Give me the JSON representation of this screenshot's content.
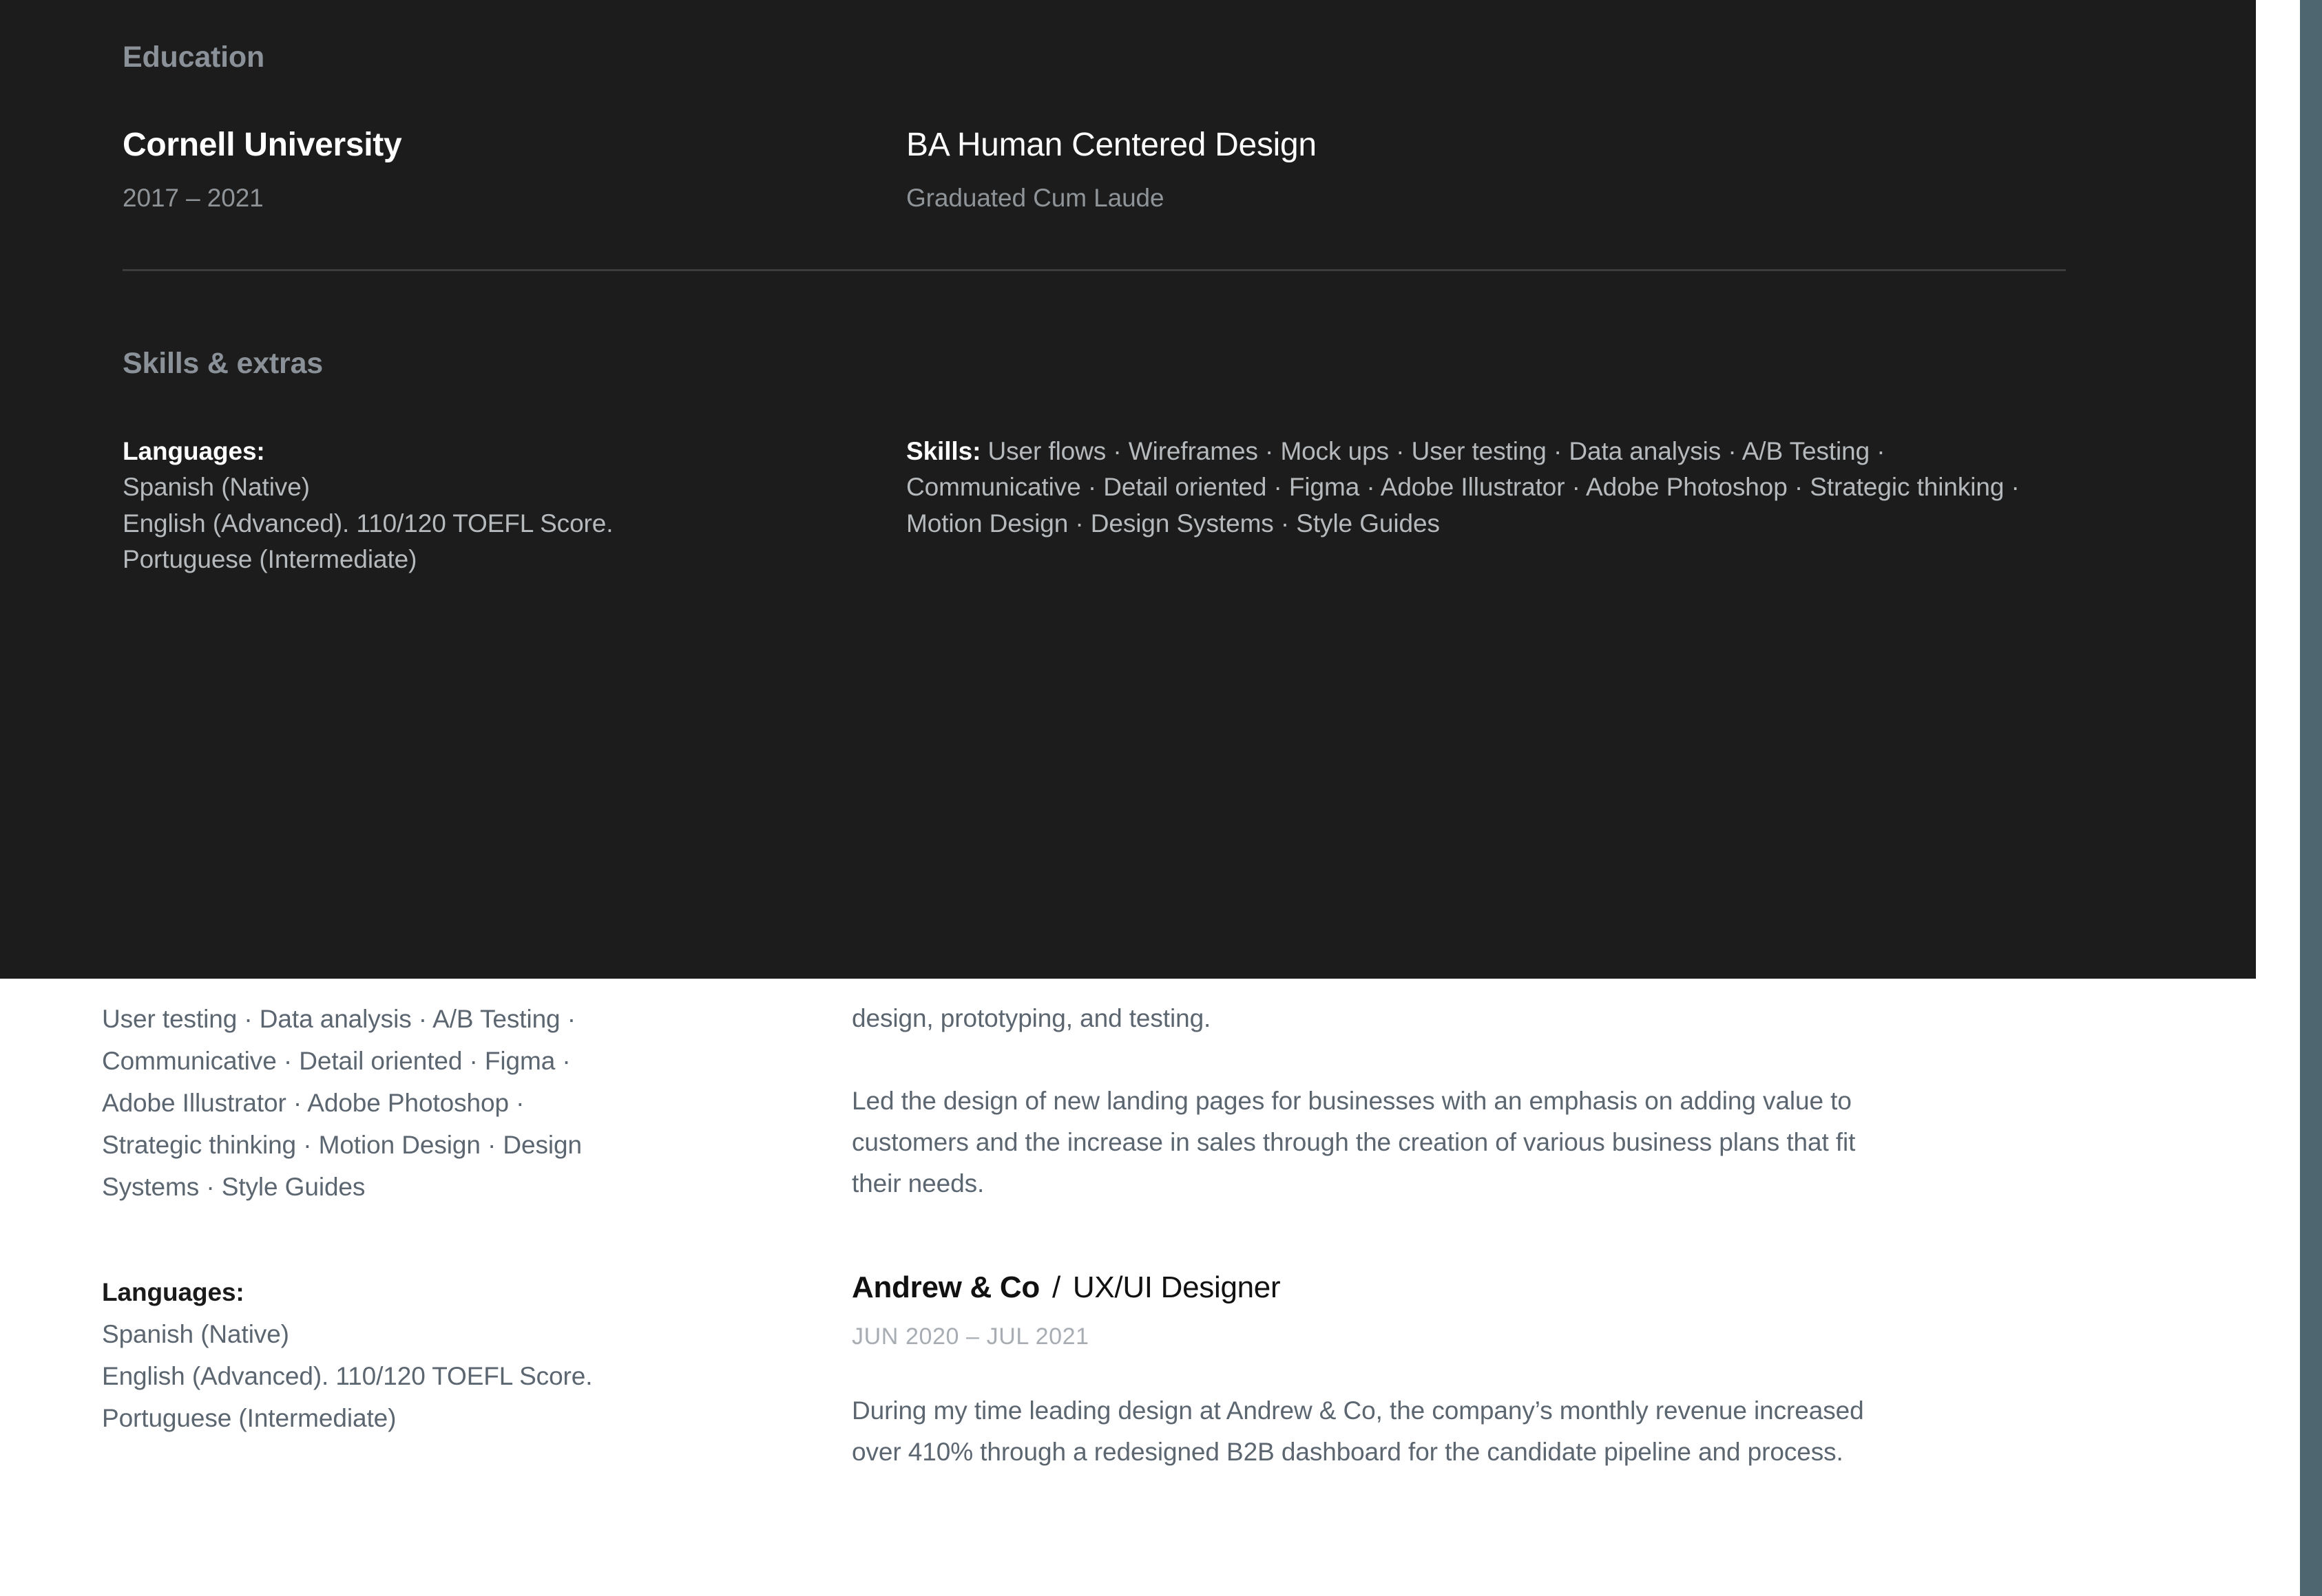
{
  "colors": {
    "dark_panel_bg": "#1c1c1c",
    "page_bg": "#ffffff",
    "heading_gray": "#8b9198",
    "body_gray_dark": "#b6babd",
    "body_gray_light": "#5c6670",
    "muted": "#a7adb3",
    "divider": "#3a3c3e",
    "scrollbar": "#4d6670"
  },
  "dark_panel": {
    "education": {
      "heading": "Education",
      "entry": {
        "school": "Cornell University",
        "years": "2017 – 2021",
        "degree": "BA Human Centered Design",
        "honors": "Graduated Cum Laude"
      }
    },
    "skills_extras": {
      "heading": "Skills & extras",
      "languages": {
        "label": "Languages:",
        "items": [
          "Spanish (Native)",
          "English (Advanced). 110/120 TOEFL Score.",
          "Portuguese (Intermediate)"
        ]
      },
      "skills": {
        "label": "Skills:",
        "text": "User flows · Wireframes · Mock ups · User testing · Data analysis · A/B Testing · Communicative · Detail oriented · Figma · Adobe Illustrator · Adobe Photoshop · Strategic thinking · Motion Design · Design Systems · Style Guides"
      }
    }
  },
  "white_section": {
    "skills_continued": "User testing · Data analysis · A/B Testing · Communicative · Detail oriented · Figma · Adobe Illustrator · Adobe Photoshop · Strategic thinking · Motion Design · Design Systems · Style Guides",
    "languages": {
      "label": "Languages:",
      "items": [
        "Spanish (Native)",
        "English (Advanced). 110/120 TOEFL Score.",
        "Portuguese (Intermediate)"
      ]
    },
    "experience_tail": {
      "clipped_line": "design, prototyping, and testing.",
      "paragraph": "Led the design of new landing pages for businesses with an emphasis on adding value to customers and the increase in sales through the creation of various business plans that fit their needs."
    },
    "experience_entry": {
      "company": "Andrew & Co",
      "separator": "/",
      "role": "UX/UI Designer",
      "dates": "JUN 2020 – JUL 2021",
      "description": "During my time leading design at Andrew & Co, the company’s monthly revenue increased over 410% through a redesigned B2B dashboard for the candidate pipeline and process."
    }
  }
}
